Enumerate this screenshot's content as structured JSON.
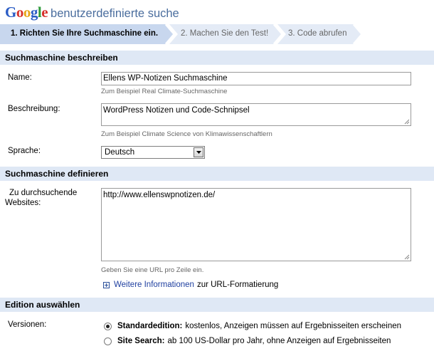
{
  "header": {
    "logo_letters": [
      {
        "char": "G",
        "color": "#2a5cc5"
      },
      {
        "char": "o",
        "color": "#d6302a"
      },
      {
        "char": "o",
        "color": "#e8a517"
      },
      {
        "char": "g",
        "color": "#2a5cc5"
      },
      {
        "char": "l",
        "color": "#2f9b3a"
      },
      {
        "char": "e",
        "color": "#d6302a"
      }
    ],
    "product": "benutzerdefinierte suche"
  },
  "steps": [
    {
      "label": "1. Richten Sie Ihre Suchmaschine ein.",
      "active": true
    },
    {
      "label": "2. Machen Sie den Test!",
      "active": false
    },
    {
      "label": "3. Code abrufen",
      "active": false
    }
  ],
  "describe": {
    "section_title": "Suchmaschine beschreiben",
    "name_label": "Name:",
    "name_value": "Ellens WP-Notizen Suchmaschine",
    "name_hint": "Zum Beispiel Real Climate-Suchmaschine",
    "desc_label": "Beschreibung:",
    "desc_value": "WordPress Notizen und Code-Schnipsel",
    "desc_hint": "Zum Beispiel Climate Science von Klimawissenschaftlern",
    "lang_label": "Sprache:",
    "lang_value": "Deutsch"
  },
  "define": {
    "section_title": "Suchmaschine definieren",
    "sites_label_1": "Zu durchsuchende",
    "sites_label_2": "Websites:",
    "sites_value": "http://www.ellenswpnotizen.de/",
    "sites_hint": "Geben Sie eine URL pro Zeile ein.",
    "more_link": "Weitere Informationen",
    "more_rest": "zur URL-Formatierung"
  },
  "edition": {
    "section_title": "Edition auswählen",
    "versions_label": "Versionen:",
    "options": [
      {
        "title": "Standardedition:",
        "text": "kostenlos, Anzeigen müssen auf Ergebnisseiten erscheinen",
        "checked": true
      },
      {
        "title": "Site Search:",
        "text": "ab 100 US-Dollar pro Jahr, ohne Anzeigen auf Ergebnisseiten",
        "checked": false
      }
    ]
  },
  "colors": {
    "section_bg": "#dfe8f5",
    "step_active": "#c8d7ee",
    "step_inactive": "#e4ebf6",
    "product_text": "#4b6e9e",
    "link": "#2040a0"
  }
}
